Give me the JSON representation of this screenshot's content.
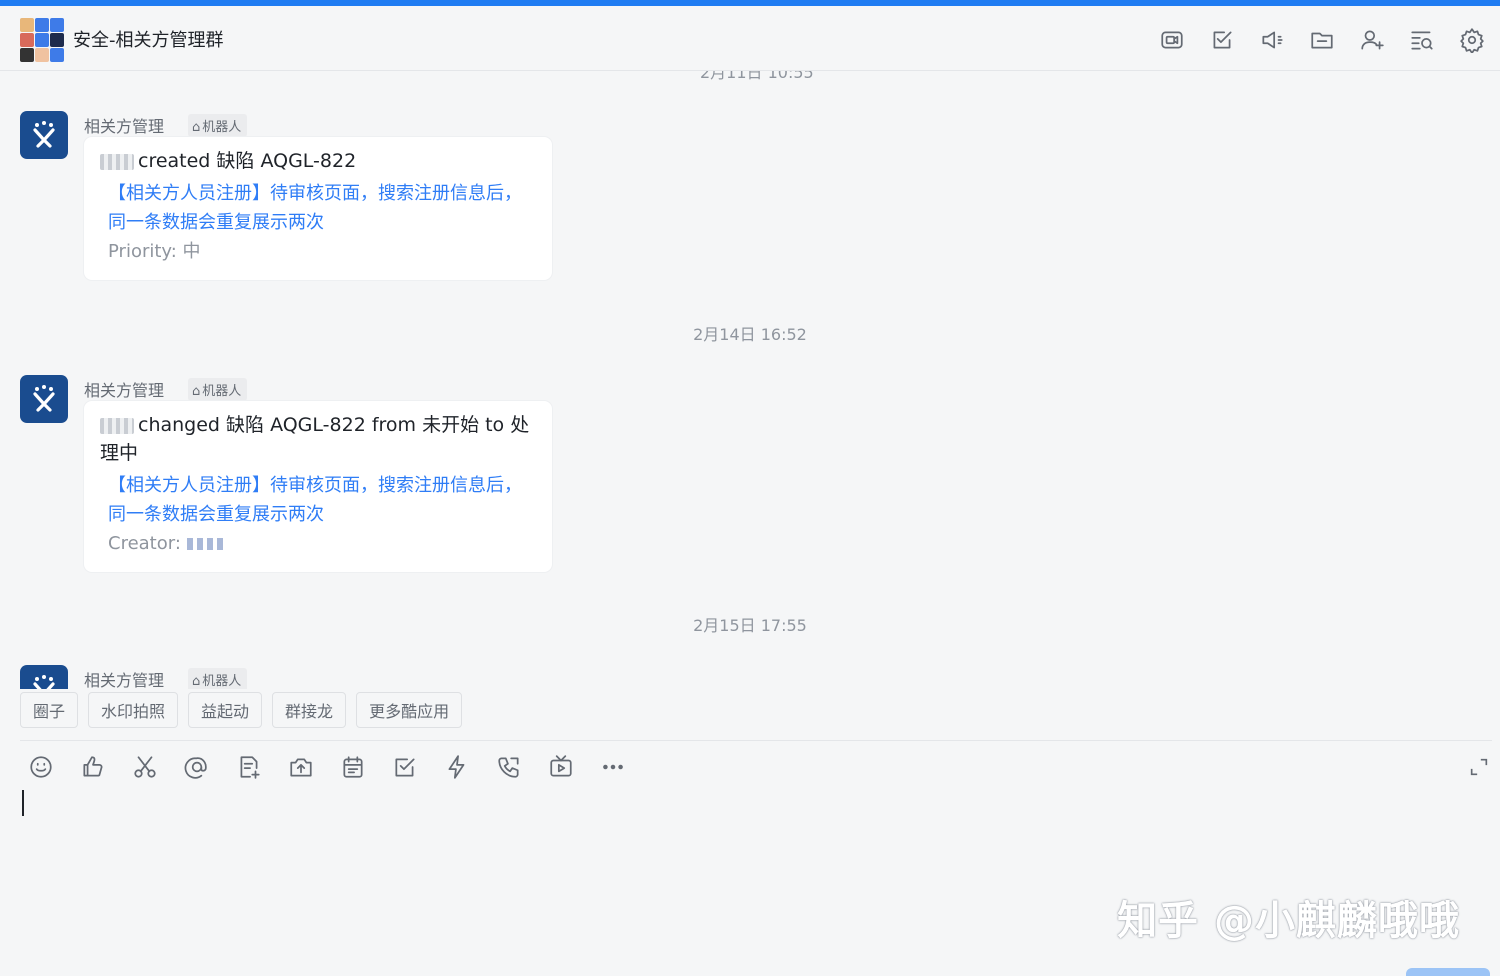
{
  "colors": {
    "accent": "#1f7cf2",
    "link": "#2f7df6",
    "bot_avatar": "#1a4c8f"
  },
  "header": {
    "title": "安全-相关方管理群",
    "icons": [
      "video-meeting-icon",
      "task-icon",
      "announcement-icon",
      "folder-icon",
      "add-member-icon",
      "search-history-icon",
      "settings-icon"
    ]
  },
  "messages": {
    "cut_time": "2月11日 10:55",
    "items": [
      {
        "sender": "相关方管理",
        "tag": "机器人",
        "line1": "created 缺陷 AQGL-822",
        "link": "【相关方人员注册】待审核页面，搜索注册信息后，同一条数据会重复展示两次",
        "meta": "Priority: 中"
      },
      {
        "time": "2月14日 16:52",
        "sender": "相关方管理",
        "tag": "机器人",
        "line1": "changed 缺陷 AQGL-822 from 未开始 to 处理中",
        "link": "【相关方人员注册】待审核页面，搜索注册信息后，同一条数据会重复展示两次",
        "meta": "Creator: "
      },
      {
        "time": "2月15日 17:55",
        "sender": "相关方管理",
        "tag": "机器人"
      }
    ]
  },
  "quick_apps": [
    "圈子",
    "水印拍照",
    "益起动",
    "群接龙",
    "更多酷应用"
  ],
  "toolbar_icons": [
    "emoji-icon",
    "thumbs-up-icon",
    "scissors-icon",
    "mention-icon",
    "doc-add-icon",
    "upload-icon",
    "calendar-icon",
    "task-check-icon",
    "lightning-icon",
    "phone-icon",
    "live-icon",
    "more-icon"
  ],
  "watermark": "知乎 @小麒麟哦哦"
}
